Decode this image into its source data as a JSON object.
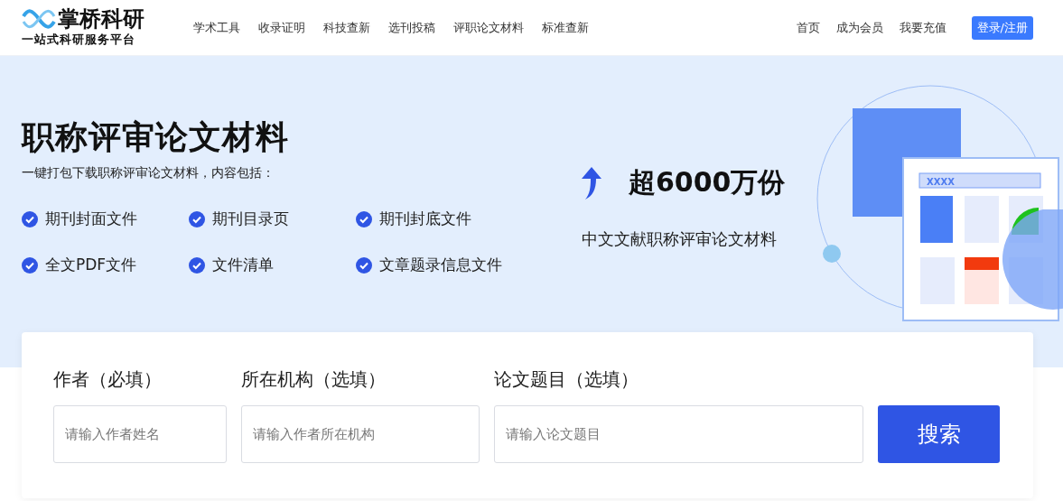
{
  "header": {
    "logo": {
      "name": "掌桥科研",
      "tagline": "一站式科研服务平台"
    },
    "nav": [
      "学术工具",
      "收录证明",
      "科技查新",
      "选刊投稿",
      "评职论文材料",
      "标准查新"
    ],
    "right_links": [
      "首页",
      "成为会员",
      "我要充值"
    ],
    "login_button": "登录/注册"
  },
  "hero": {
    "title": "职称评审论文材料",
    "subtitle": "一键打包下载职称评审论文材料，内容包括：",
    "features": [
      "期刊封面文件",
      "期刊目录页",
      "期刊封底文件",
      "全文PDF文件",
      "文件清单",
      "文章题录信息文件"
    ],
    "stat": "超6000万份",
    "stat_caption": "中文文献职称评审论文材料",
    "illustration_label": "XXXX"
  },
  "search": {
    "fields": [
      {
        "label": "作者（必填）",
        "placeholder": "请输入作者姓名"
      },
      {
        "label": "所在机构（选填）",
        "placeholder": "请输入作者所在机构"
      },
      {
        "label": "论文题目（选填）",
        "placeholder": "请输入论文题目"
      }
    ],
    "button": "搜索"
  }
}
